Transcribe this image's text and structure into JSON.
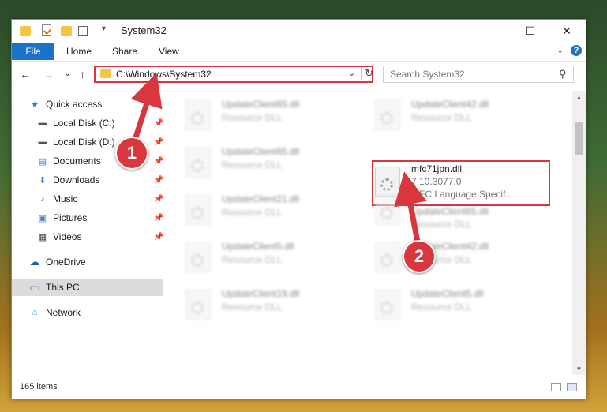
{
  "window": {
    "title": "System32",
    "controls": {
      "minimize": "—",
      "maximize": "☐",
      "close": "✕"
    }
  },
  "ribbon": {
    "tabs": [
      "File",
      "Home",
      "Share",
      "View"
    ],
    "collapse_glyph": "⌄",
    "help_glyph": "?"
  },
  "nav": {
    "back": "←",
    "forward": "→",
    "recent": "⌄",
    "up": "↑",
    "address": "C:\\Windows\\System32",
    "address_dropdown": "⌄",
    "refresh": "↻",
    "search_placeholder": "Search System32",
    "search_glyph": "⚲"
  },
  "sidebar": {
    "items": [
      {
        "label": "Quick access",
        "icon": "star-icon",
        "glyph": "★",
        "color": "#2a7bd4"
      },
      {
        "label": "Local Disk (C:)",
        "icon": "drive-icon",
        "glyph": "▬",
        "color": "#555555",
        "pinned": true
      },
      {
        "label": "Local Disk (D:)",
        "icon": "drive-icon",
        "glyph": "▬",
        "color": "#555555",
        "pinned": true
      },
      {
        "label": "Documents",
        "icon": "documents-icon",
        "glyph": "▤",
        "color": "#4a7fb8",
        "pinned": true
      },
      {
        "label": "Downloads",
        "icon": "downloads-icon",
        "glyph": "⬇",
        "color": "#2a7bd4",
        "pinned": true
      },
      {
        "label": "Music",
        "icon": "music-icon",
        "glyph": "♪",
        "color": "#2a7bd4",
        "pinned": true
      },
      {
        "label": "Pictures",
        "icon": "pictures-icon",
        "glyph": "▣",
        "color": "#4a7fb8",
        "pinned": true
      },
      {
        "label": "Videos",
        "icon": "videos-icon",
        "glyph": "▦",
        "color": "#444444",
        "pinned": true
      },
      {
        "label": "OneDrive",
        "icon": "onedrive-icon",
        "glyph": "☁",
        "color": "#1e5fb3"
      },
      {
        "label": "This PC",
        "icon": "this-pc-icon",
        "glyph": "▭",
        "color": "#2a7bd4",
        "selected": true
      },
      {
        "label": "Network",
        "icon": "network-icon",
        "glyph": "⌂",
        "color": "#2a7bd4"
      }
    ],
    "pin_glyph": "📌"
  },
  "files": {
    "left": [
      {
        "name": "UpdateClient65.dll",
        "type": "Resource DLL"
      },
      {
        "name": "UpdateClient65.dll",
        "type": "Resource DLL"
      },
      {
        "name": "UpdateClient21.dll",
        "type": "Resource DLL"
      },
      {
        "name": "UpdateClient5.dll",
        "type": "Resource DLL"
      },
      {
        "name": "UpdateClient19.dll",
        "type": "Resource DLL"
      }
    ],
    "right": [
      {
        "name": "UpdateClient42.dll",
        "type": "Resource DLL"
      },
      {
        "name": "UpdateClient65.dll",
        "type": "Resource DLL"
      },
      {
        "name": "UpdateClient42.dll",
        "type": "Resource DLL"
      },
      {
        "name": "UpdateClient5.dll",
        "type": "Resource DLL"
      }
    ],
    "highlighted": {
      "name": "mfc71jpn.dll",
      "version": "7.10.3077.0",
      "description": "MFC Language Specif..."
    }
  },
  "status": {
    "items_count": "165 items"
  },
  "callouts": [
    "1",
    "2"
  ],
  "colors": {
    "accent": "#1a73c8",
    "highlight": "#d9363e"
  }
}
